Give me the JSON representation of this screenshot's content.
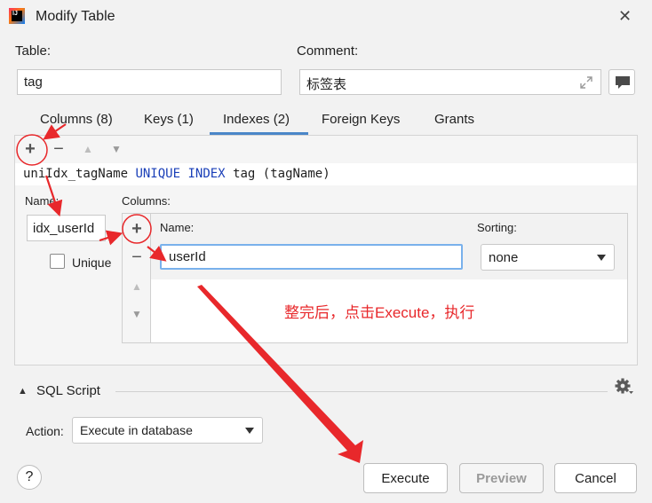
{
  "window": {
    "title": "Modify Table",
    "app_icon": "intellij-idea-icon",
    "close_glyph": "✕"
  },
  "table": {
    "label": "Table:",
    "value": "tag"
  },
  "comment": {
    "label": "Comment:",
    "value": "标签表"
  },
  "tabs": [
    {
      "label": "Columns (8)",
      "active": false
    },
    {
      "label": "Keys (1)",
      "active": false
    },
    {
      "label": "Indexes (2)",
      "active": true
    },
    {
      "label": "Foreign Keys",
      "active": false
    },
    {
      "label": "Grants",
      "active": false
    }
  ],
  "toolbar": {
    "add": "+",
    "remove": "−",
    "up": "▲",
    "down": "▼"
  },
  "index_list": {
    "row": {
      "name": "uniIdx_tagName",
      "kw_unique": "UNIQUE",
      "kw_index": "INDEX",
      "rest": "tag (tagName)"
    }
  },
  "index_detail": {
    "name_label": "Name:",
    "name_value": "idx_userId",
    "unique_label": "Unique",
    "unique_checked": false,
    "columns_label": "Columns:",
    "col_name_header": "Name:",
    "col_sorting_header": "Sorting:",
    "col_value": "userId",
    "sorting_value": "none"
  },
  "annotation_text": "整完后，点击Execute，执行",
  "sql_script": {
    "label": "SQL Script"
  },
  "action": {
    "label": "Action:",
    "value": "Execute in database"
  },
  "buttons": {
    "help": "?",
    "execute": "Execute",
    "preview": "Preview",
    "cancel": "Cancel"
  },
  "colors": {
    "accent": "#3d7fd8",
    "annotation": "#e8282b",
    "tab_underline": "#4a86c8"
  }
}
